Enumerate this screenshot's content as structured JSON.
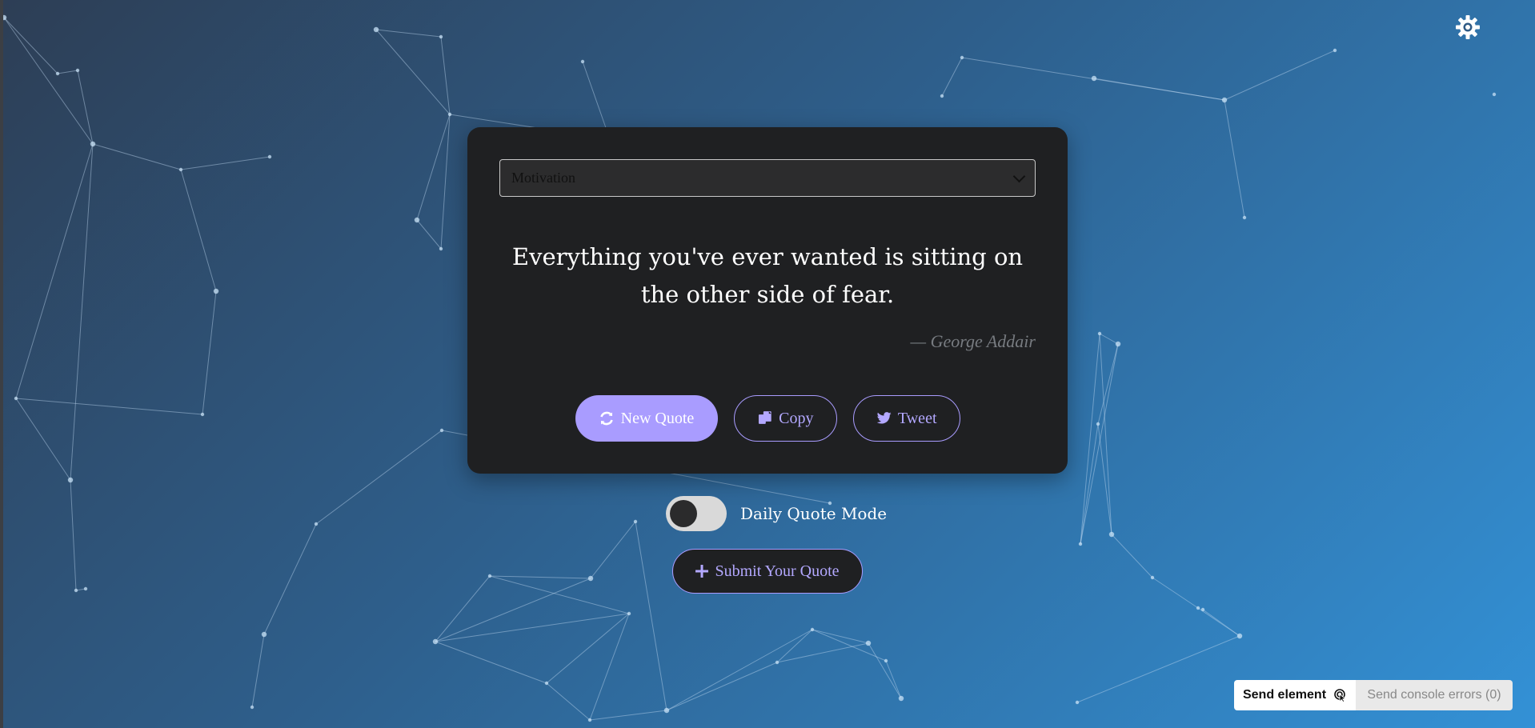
{
  "category_select": {
    "value": "Motivation"
  },
  "quote": {
    "text": "Everything you've ever wanted is sitting on the other side of fear.",
    "author": "— George Addair"
  },
  "buttons": {
    "new_quote": "New Quote",
    "copy": "Copy",
    "tweet": "Tweet"
  },
  "daily_mode": {
    "label": "Daily Quote Mode",
    "enabled": false
  },
  "submit": {
    "label": "Submit Your Quote"
  },
  "dev_toolbar": {
    "send_element": "Send element",
    "send_console_errors": "Send console errors (0)"
  },
  "colors": {
    "accent": "#a99cff",
    "card_bg": "#1f2022",
    "bg_start": "#2d3e55",
    "bg_end": "#3391d6"
  },
  "icons": {
    "settings": "gear-icon",
    "new_quote": "refresh-icon",
    "copy": "copy-icon",
    "tweet": "twitter-icon",
    "submit": "plus-icon",
    "send_element": "pointer-select-icon"
  }
}
